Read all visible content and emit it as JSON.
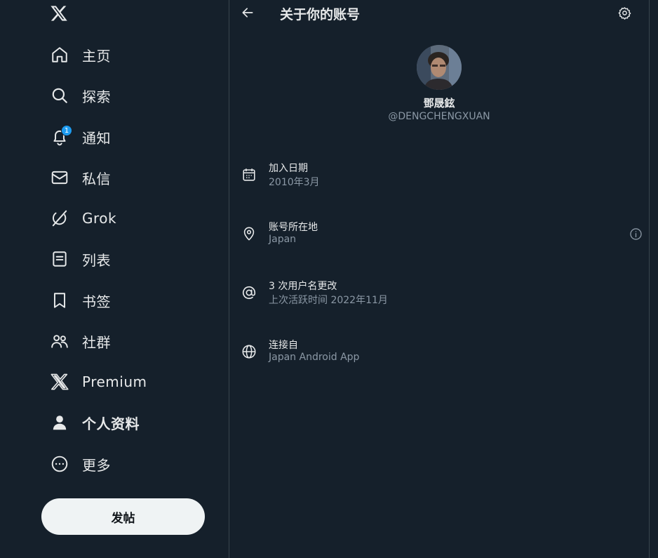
{
  "sidebar": {
    "logo_icon": "x-logo-icon",
    "items": [
      {
        "label": "主页",
        "icon": "home-icon"
      },
      {
        "label": "探索",
        "icon": "search-icon"
      },
      {
        "label": "通知",
        "icon": "bell-icon",
        "badge": "1"
      },
      {
        "label": "私信",
        "icon": "mail-icon"
      },
      {
        "label": "Grok",
        "icon": "grok-icon"
      },
      {
        "label": "列表",
        "icon": "list-icon"
      },
      {
        "label": "书签",
        "icon": "bookmark-icon"
      },
      {
        "label": "社群",
        "icon": "communities-icon"
      },
      {
        "label": "Premium",
        "icon": "x-premium-icon"
      },
      {
        "label": "个人资料",
        "icon": "profile-icon",
        "active": true
      },
      {
        "label": "更多",
        "icon": "more-icon"
      }
    ],
    "post_button": "发帖"
  },
  "header": {
    "title": "关于你的账号",
    "back_icon": "back-arrow-icon",
    "settings_icon": "gear-icon"
  },
  "profile": {
    "name": "鄧晟鉉",
    "handle": "@DENGCHENGXUAN"
  },
  "details": [
    {
      "icon": "calendar-icon",
      "title": "加入日期",
      "value": "2010年3月"
    },
    {
      "icon": "location-icon",
      "title": "账号所在地",
      "value": "Japan",
      "help_icon": "info-icon"
    },
    {
      "icon": "at-icon",
      "title": "3 次用户名更改",
      "value": "上次活跃时间 2022年11月"
    },
    {
      "icon": "globe-icon",
      "title": "连接自",
      "value": "Japan Android App"
    }
  ],
  "colors": {
    "background": "#15202b",
    "text_primary": "#e7e9ea",
    "text_secondary": "#8b98a5",
    "accent": "#1d9bf0",
    "border": "#38444d",
    "button_bg": "#eff3f4"
  }
}
